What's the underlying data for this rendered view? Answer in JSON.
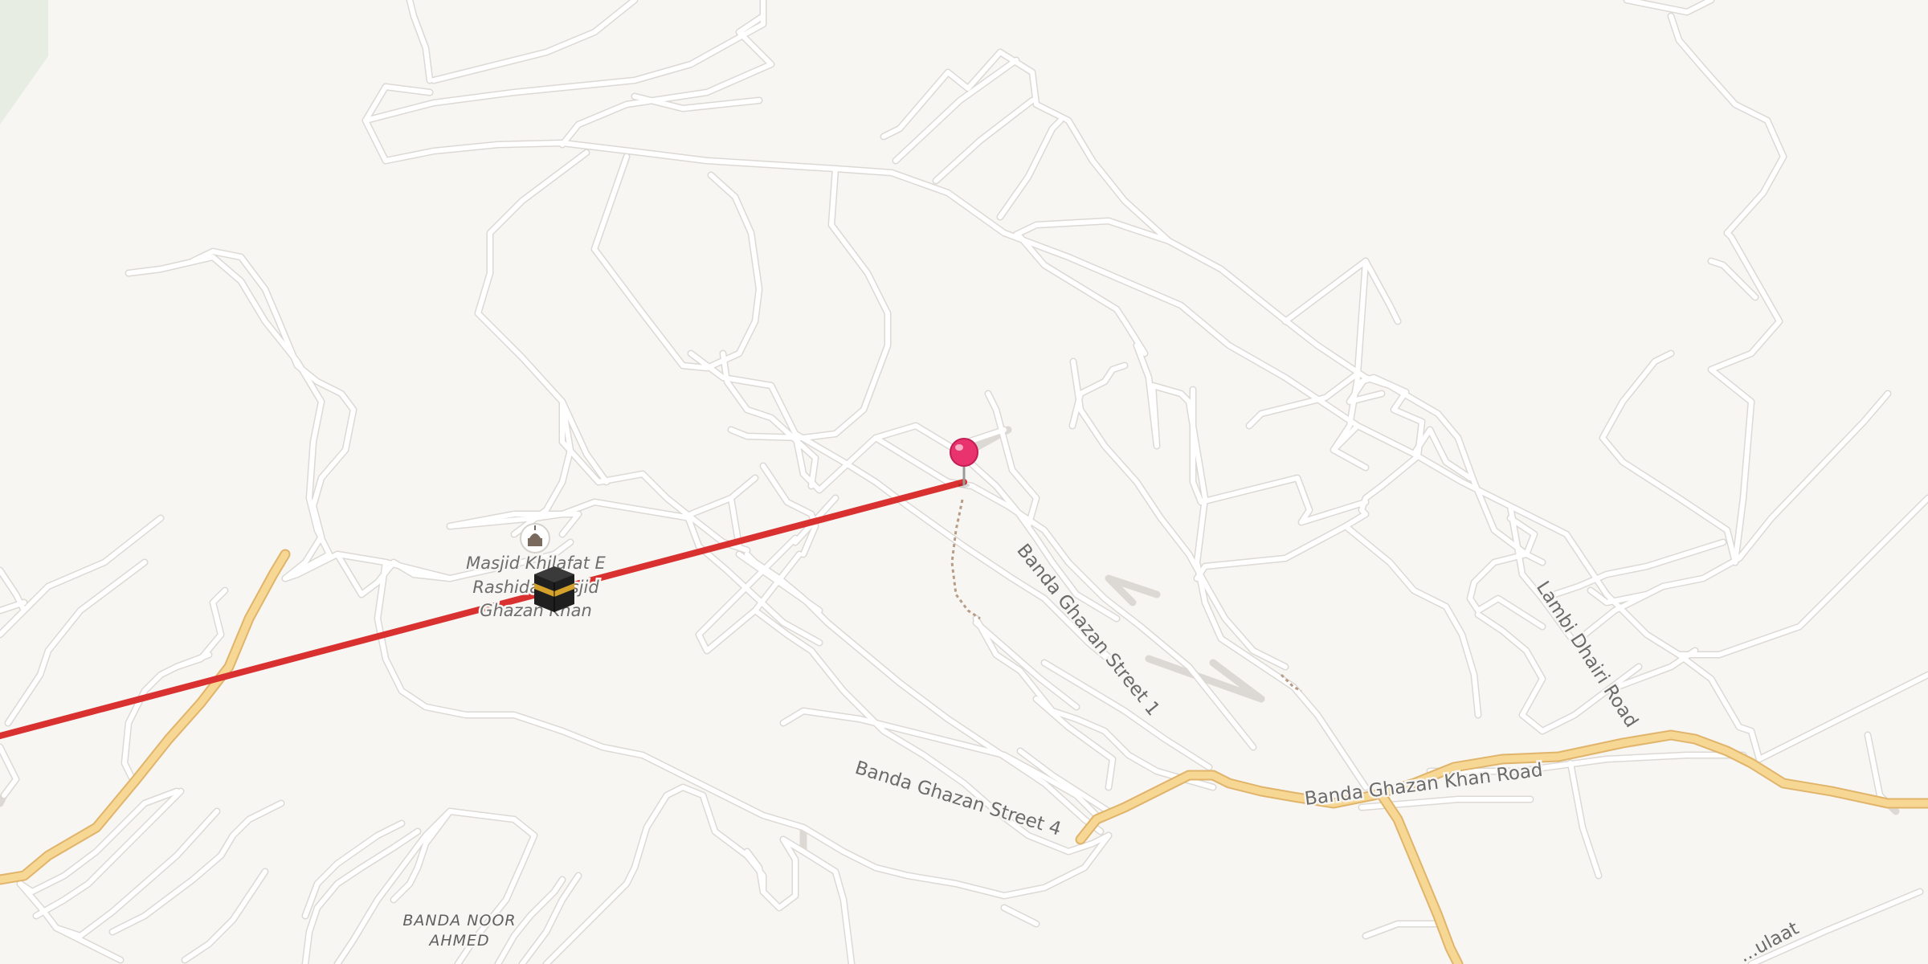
{
  "map": {
    "roads": {
      "major": [
        "Banda Ghazan Khan Road"
      ],
      "streets": [
        "Banda Ghazan Street 1",
        "Banda Ghazan Street 4",
        "Lambi Dhairi Road"
      ],
      "partial": [
        "...ulaat"
      ]
    },
    "poi": {
      "mosque_name_line1": "Masjid Khilafat E",
      "mosque_name_line2": "Rashida Masjid",
      "mosque_name_line3": "Ghazan Khan",
      "mosque_icon": "mosque-icon",
      "kaaba_icon": "kaaba-icon"
    },
    "area": {
      "line1": "BANDA NOOR",
      "line2": "AHMED"
    },
    "marker": {
      "icon": "map-pin-icon",
      "color": "#e8336f"
    },
    "route": {
      "color": "#d93030"
    },
    "colors": {
      "background": "#f8f6f3",
      "major_road": "#f7d794",
      "minor_road": "#ffffff",
      "park": "#e8ede3"
    }
  }
}
